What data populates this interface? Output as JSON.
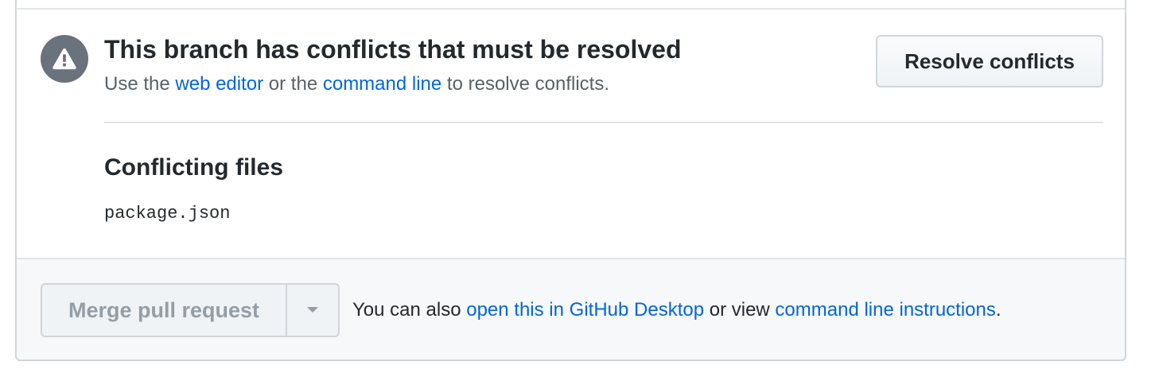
{
  "conflict": {
    "title": "This branch has conflicts that must be resolved",
    "desc_prefix": "Use the ",
    "web_editor_link": "web editor",
    "desc_middle": " or the ",
    "command_line_link": "command line",
    "desc_suffix": " to resolve conflicts.",
    "resolve_button": "Resolve conflicts",
    "icon": "alert-icon"
  },
  "files": {
    "heading": "Conflicting files",
    "items": [
      "package.json"
    ]
  },
  "footer": {
    "merge_button": "Merge pull request",
    "merge_disabled": true,
    "caret_icon": "triangle-down-icon",
    "text_prefix": "You can also ",
    "desktop_link": "open this in GitHub Desktop",
    "text_middle": " or view ",
    "instructions_link": "command line instructions",
    "text_suffix": "."
  },
  "colors": {
    "link": "#0366d6",
    "icon_bg": "#6a737d",
    "disabled_text": "#959da5",
    "footer_bg": "#f6f8fa"
  }
}
